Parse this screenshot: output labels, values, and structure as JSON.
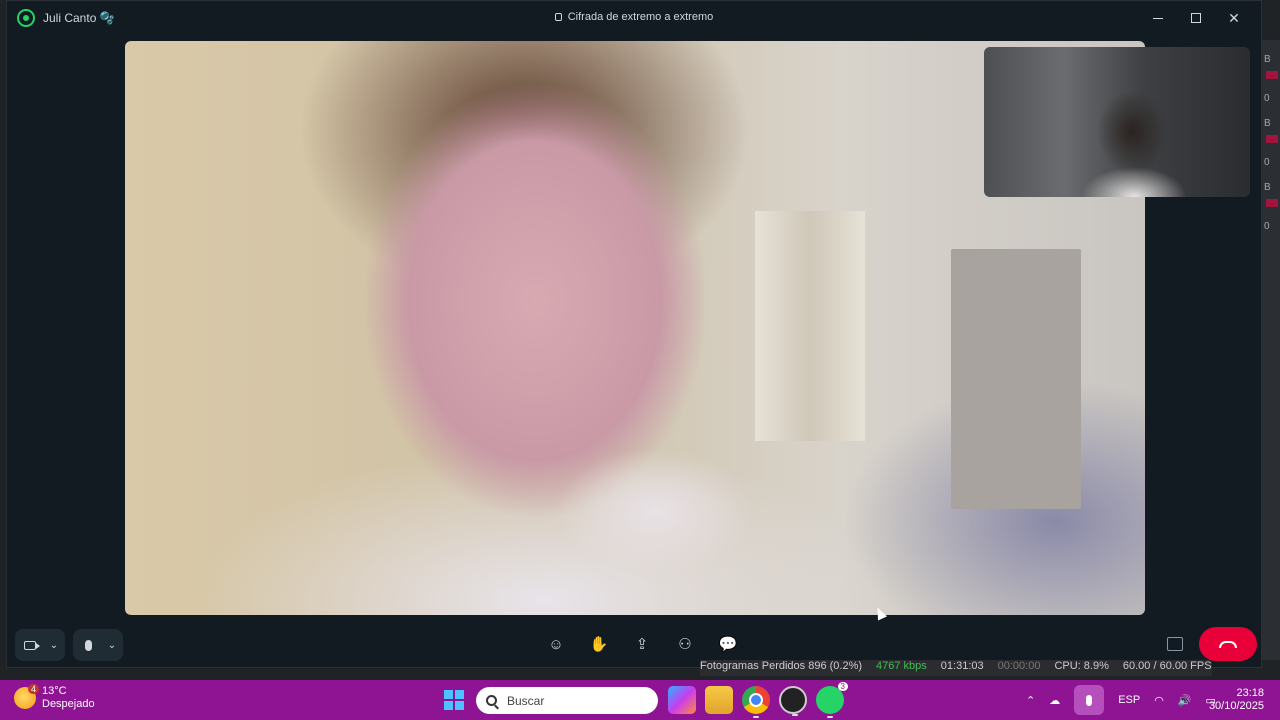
{
  "window": {
    "contact_name": "Juli Canto 🫧",
    "encryption_label": "Cifrada de extremo a extremo",
    "min_label": "–",
    "max_label": "□",
    "close_label": "✕"
  },
  "call_controls": {
    "left": [
      "camera",
      "microphone"
    ],
    "center_icons": [
      "emoji-icon",
      "raise-hand-icon",
      "share-screen-icon",
      "add-person-icon",
      "chat-icon"
    ],
    "end_call_color": "#ea0038"
  },
  "obs_status": {
    "dropped_frames": "Fotogramas Perdidos 896 (0.2%)",
    "bitrate": "4767 kbps",
    "stream_time": "01:31:03",
    "rec_time": "00:00:00",
    "cpu": "CPU: 8.9%",
    "fps": "60.00 / 60.00 FPS"
  },
  "taskbar": {
    "weather_badge": "4",
    "temperature": "13°C",
    "condition": "Despejado",
    "search_placeholder": "Buscar",
    "whatsapp_badge": "3",
    "language": "ESP",
    "time": "23:18",
    "date": "30/10/2025",
    "accent": "#8e1494"
  },
  "side_panel": {
    "labels": [
      "B",
      "0",
      "B",
      "0",
      "B",
      "0"
    ]
  }
}
